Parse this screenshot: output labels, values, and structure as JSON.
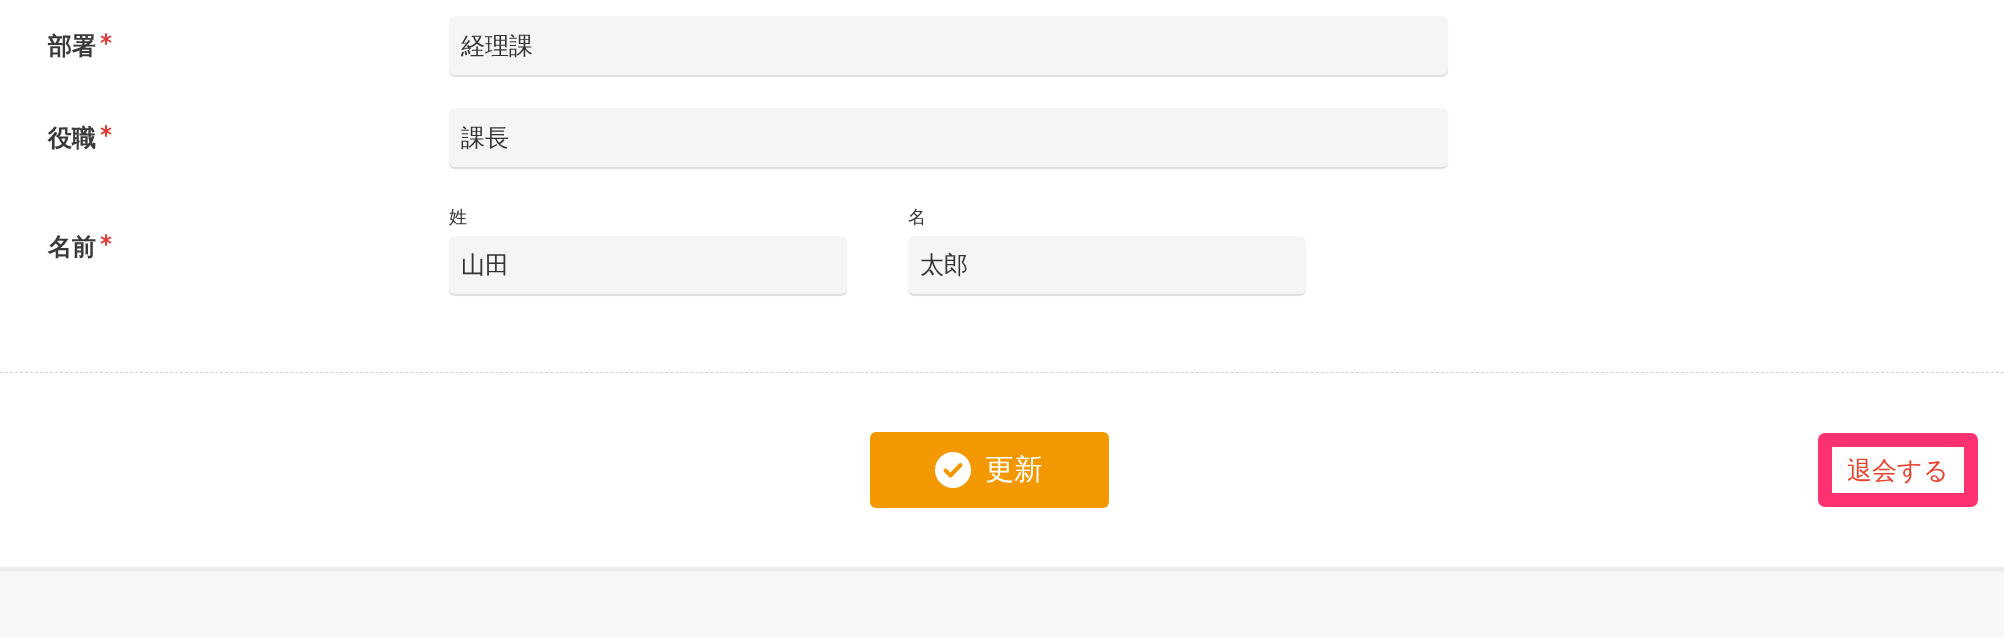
{
  "fields": [
    {
      "kind": "text",
      "label": "部署",
      "required": true,
      "value": "経理課"
    },
    {
      "kind": "text",
      "label": "役職",
      "required": true,
      "value": "課長"
    },
    {
      "kind": "split",
      "label": "名前",
      "required": true,
      "parts": [
        {
          "label": "姓",
          "value": "山田"
        },
        {
          "label": "名",
          "value": "太郎"
        }
      ]
    }
  ],
  "actions": {
    "update": {
      "label": "更新"
    },
    "withdraw": {
      "label": "退会する"
    }
  }
}
